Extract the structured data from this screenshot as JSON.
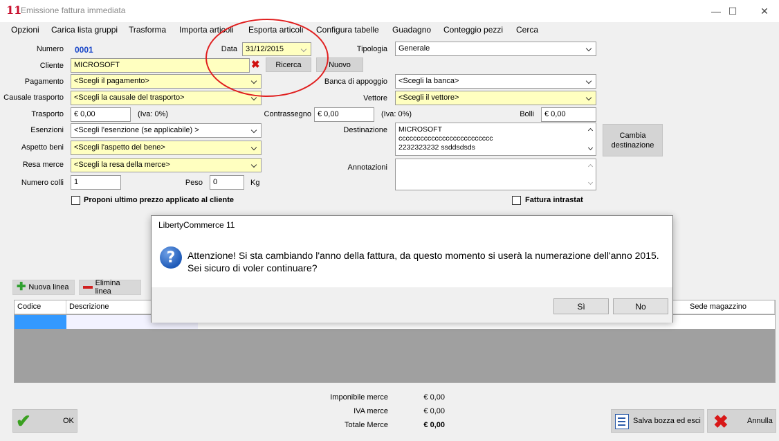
{
  "window": {
    "title": "Emissione fattura immediata",
    "logo_text": "11",
    "controls": {
      "minimize": "—",
      "maximize": "☐",
      "close": "✕"
    }
  },
  "menu": [
    "Opzioni",
    "Carica lista gruppi",
    "Trasforma",
    "Importa articoli",
    "Esporta articoli",
    "Configura tabelle",
    "Guadagno",
    "Conteggio pezzi",
    "Cerca"
  ],
  "form": {
    "numero": {
      "label": "Numero",
      "value": "0001"
    },
    "data": {
      "label": "Data",
      "value": "31/12/2015"
    },
    "tipologia": {
      "label": "Tipologia",
      "value": "Generale"
    },
    "cliente": {
      "label": "Cliente",
      "value": "MICROSOFT",
      "search_button": "Ricerca",
      "new_button": "Nuovo"
    },
    "pagamento": {
      "label": "Pagamento",
      "value": "<Scegli il pagamento>"
    },
    "banca": {
      "label": "Banca di appoggio",
      "value": "<Scegli la banca>"
    },
    "causale": {
      "label": "Causale trasporto",
      "value": "<Scegli la causale del trasporto>"
    },
    "vettore": {
      "label": "Vettore",
      "value": "<Scegli il vettore>"
    },
    "trasporto": {
      "label": "Trasporto",
      "value": "€ 0,00",
      "iva": "(Iva: 0%)"
    },
    "contrassegno": {
      "label": "Contrassegno",
      "value": "€ 0,00",
      "iva": "(Iva: 0%)"
    },
    "bolli": {
      "label": "Bolli",
      "value": "€ 0,00"
    },
    "esenzioni": {
      "label": "Esenzioni",
      "value": "<Scegli l'esenzione (se applicabile) >"
    },
    "destinazione": {
      "label": "Destinazione",
      "lines": [
        "MICROSOFT",
        "cccccccccccccccccccccccccc",
        "2232323232 ssddsdsds"
      ],
      "change_button": "Cambia destinazione"
    },
    "aspetto": {
      "label": "Aspetto beni",
      "value": "<Scegli l'aspetto del bene>"
    },
    "resa": {
      "label": "Resa merce",
      "value": "<Scegli la resa della merce>"
    },
    "annotazioni": {
      "label": "Annotazioni",
      "value": ""
    },
    "colli": {
      "label": "Numero colli",
      "value": "1"
    },
    "peso": {
      "label": "Peso",
      "value": "0",
      "unit": "Kg"
    },
    "proponi": {
      "label": "Proponi ultimo prezzo applicato al cliente",
      "checked": false
    },
    "intrastat": {
      "label": "Fattura intrastat",
      "checked": false
    }
  },
  "toolbar": {
    "add_line": "Nuova linea",
    "delete_line": "Elimina linea"
  },
  "grid": {
    "columns": [
      "Codice",
      "Descrizione",
      "Sede magazzino"
    ]
  },
  "totals": {
    "imponibile": {
      "label": "Imponibile merce",
      "value": "€ 0,00"
    },
    "iva": {
      "label": "IVA merce",
      "value": "€ 0,00"
    },
    "totale": {
      "label": "Totale Merce",
      "value": "€ 0,00"
    }
  },
  "footer": {
    "ok": "OK",
    "save_draft": "Salva bozza ed esci",
    "cancel": "Annulla"
  },
  "dialog": {
    "title": "LibertyCommerce 11",
    "message_line1": "Attenzione! Si sta cambiando l'anno della fattura, da questo momento si userà la numerazione dell'anno 2015.",
    "message_line2": "Sei sicuro di voler continuare?",
    "yes": "Sì",
    "no": "No"
  },
  "colors": {
    "required_field": "#ffffc0",
    "annotation": "#e02020",
    "link": "#1a47c8"
  }
}
